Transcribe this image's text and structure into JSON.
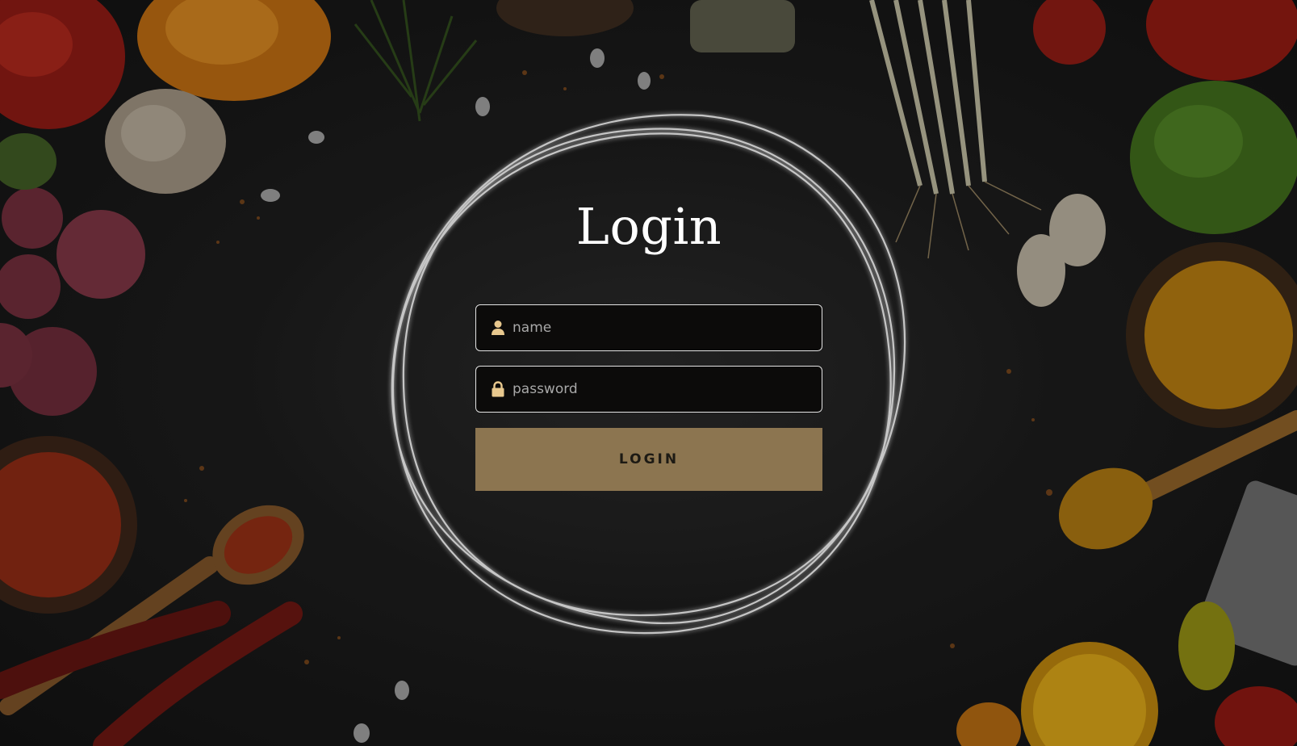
{
  "login": {
    "title": "Login",
    "name_placeholder": "name",
    "password_placeholder": "password",
    "button_label": "LOGIN",
    "name_icon": "user-icon",
    "password_icon": "lock-icon"
  },
  "colors": {
    "accent": "#8c7550",
    "icon": "#e8c88e",
    "input_bg": "#0c0b0a",
    "border": "#e3e3e3"
  }
}
